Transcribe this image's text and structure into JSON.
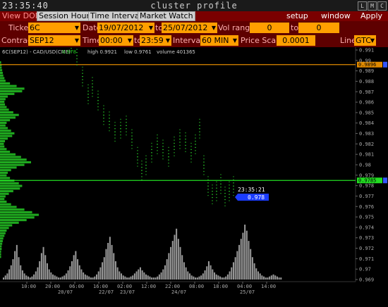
{
  "titlebar": {
    "clock": "23:35:40",
    "title": "cluster profile",
    "buttons": [
      "L",
      "M",
      "C"
    ]
  },
  "menu": {
    "items": [
      "View DOM",
      "Session Hours",
      "Time Interval",
      "Market Watch"
    ],
    "right_items": [
      "setup",
      "window",
      "Apply"
    ]
  },
  "controls": {
    "ticker_label": "Ticker",
    "ticker_value": "6C",
    "date_label": "Date",
    "date_from": "19/07/2012",
    "date_to_label": "to",
    "date_to": "25/07/2012",
    "vol_range_label": "Vol range",
    "vol_from": "0",
    "vol_to_label": "to",
    "vol_to": "0",
    "contract_label": "Contract",
    "contract_value": "SEP12",
    "time_label": "Time",
    "time_from": "00:00",
    "time_to_label": "to",
    "time_to": "23:59",
    "interval_label": "Interval",
    "interval_value": "60 MIN",
    "price_scale_label": "Price Scale",
    "price_scale_value": "0.0001",
    "line_label": "Line",
    "line_value": "GTC"
  },
  "info": {
    "symbol": "6C(SEP12) - CAD/USD(CME)",
    "last": "0.978",
    "high": "high 0.9921",
    "low": "low 0.9761",
    "volume": "volume 401365"
  },
  "overlay": {
    "time": "23:35:21",
    "price": "0.978"
  },
  "colors": {
    "menu_bg": "#7a0000",
    "ctrl_bg": "#5e0000",
    "field": "#ff9f00",
    "profile_green": "#1fa81f",
    "line_green": "#22dd22",
    "line_orange": "#e08a00",
    "price_tag_blue": "#1b3cff",
    "bar_green": "#23b023"
  },
  "chart_data": {
    "type": "bar",
    "price_axis": {
      "min": 0.969,
      "max": 0.991,
      "labels": [
        "0.991",
        "0.99",
        "0.989",
        "0.988",
        "0.987",
        "0.986",
        "0.985",
        "0.984",
        "0.983",
        "0.982",
        "0.981",
        "0.98",
        "0.979",
        "0.978",
        "0.977",
        "0.976",
        "0.975",
        "0.974",
        "0.973",
        "0.972",
        "0.971",
        "0.97",
        "0.969"
      ],
      "markers": [
        {
          "price": "0.9919",
          "color": "#22dd22"
        },
        {
          "price": "0.9896",
          "color": "#e08a00"
        },
        {
          "price": "0.9785",
          "color": "#22dd22"
        }
      ]
    },
    "time_axis": {
      "ticks": [
        "10:00",
        "20:00",
        "06:00",
        "16:00",
        "02:00",
        "12:00",
        "22:00",
        "08:00",
        "18:00",
        "04:00",
        "14:00"
      ],
      "dates": [
        "20/07",
        "22/07",
        "23/07",
        "24/07",
        "25/07"
      ]
    },
    "volume_values": [
      2,
      4,
      6,
      10,
      14,
      20,
      28,
      34,
      22,
      14,
      9,
      6,
      4,
      3,
      2,
      3,
      5,
      8,
      12,
      18,
      26,
      32,
      24,
      16,
      10,
      7,
      5,
      4,
      3,
      2,
      2,
      3,
      4,
      6,
      9,
      13,
      18,
      24,
      28,
      20,
      14,
      10,
      7,
      5,
      4,
      3,
      2,
      2,
      3,
      5,
      8,
      12,
      17,
      22,
      30,
      36,
      42,
      34,
      26,
      18,
      12,
      8,
      6,
      4,
      3,
      2,
      2,
      3,
      4,
      6,
      8,
      10,
      12,
      9,
      7,
      5,
      4,
      3,
      2,
      2,
      2,
      3,
      5,
      7,
      10,
      14,
      20,
      26,
      32,
      38,
      44,
      50,
      40,
      32,
      24,
      17,
      12,
      8,
      6,
      4,
      3,
      2,
      2,
      3,
      4,
      6,
      9,
      13,
      18,
      14,
      10,
      7,
      5,
      4,
      3,
      2,
      2,
      3,
      5,
      8,
      12,
      17,
      22,
      28,
      34,
      40,
      46,
      54,
      48,
      38,
      30,
      22,
      16,
      11,
      8,
      6,
      4,
      3,
      2,
      2,
      3,
      4,
      5,
      4,
      3,
      2,
      2
    ],
    "price_profile": [
      2,
      3,
      3,
      4,
      5,
      6,
      8,
      10,
      18,
      30,
      44,
      40,
      26,
      14,
      10,
      8,
      9,
      12,
      16,
      24,
      34,
      28,
      18,
      12,
      10,
      14,
      20,
      26,
      22,
      14,
      9,
      7,
      8,
      12,
      18,
      28,
      38,
      48,
      56,
      44,
      30,
      20,
      14,
      12,
      18,
      26,
      34,
      40,
      36,
      24,
      16,
      10,
      8,
      12,
      20,
      30,
      44,
      58,
      70,
      62,
      48,
      34,
      22,
      16,
      12,
      10,
      8,
      6,
      5,
      4,
      3,
      3,
      2,
      2,
      2
    ]
  }
}
